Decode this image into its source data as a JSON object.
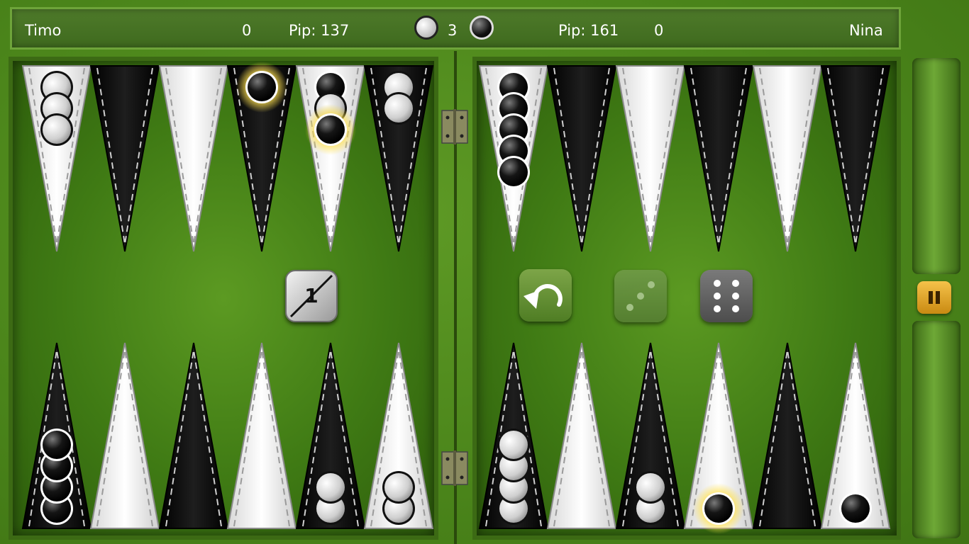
{
  "header": {
    "player_left": "Timo",
    "score_left": "0",
    "pip_left": "Pip: 137",
    "cube_value": "3",
    "pip_right": "Pip: 161",
    "score_right": "0",
    "player_right": "Nina"
  },
  "controls": {
    "doubling_cube_value": "1",
    "undo_icon": "undo-arrow-icon",
    "pause_icon": "pause-icon"
  },
  "dice": [
    {
      "value": 3,
      "used": true
    },
    {
      "value": 6,
      "used": false
    }
  ],
  "colors": {
    "felt": "#4a841a",
    "point_light": "#ffffff",
    "point_dark": "#111111",
    "highlight": "#ffe14d",
    "pause_button": "#e0a628"
  },
  "board": {
    "top_left_points": [
      {
        "point": 1,
        "checkers": 3,
        "color": "white"
      },
      {
        "point": 2,
        "checkers": 0,
        "color": null
      },
      {
        "point": 3,
        "checkers": 0,
        "color": null
      },
      {
        "point": 4,
        "checkers": 1,
        "color": "black",
        "highlight": true
      },
      {
        "point": 5,
        "checkers": 3,
        "color": "mixed",
        "highlight": true
      },
      {
        "point": 6,
        "checkers": 2,
        "color": "white"
      }
    ],
    "top_right_points": [
      {
        "point": 7,
        "checkers": 5,
        "color": "black"
      },
      {
        "point": 8,
        "checkers": 0,
        "color": null
      },
      {
        "point": 9,
        "checkers": 0,
        "color": null
      },
      {
        "point": 10,
        "checkers": 0,
        "color": null
      },
      {
        "point": 11,
        "checkers": 0,
        "color": null
      },
      {
        "point": 12,
        "checkers": 0,
        "color": null
      }
    ],
    "bottom_left_points": [
      {
        "point": 13,
        "checkers": 4,
        "color": "black"
      },
      {
        "point": 14,
        "checkers": 0,
        "color": null
      },
      {
        "point": 15,
        "checkers": 0,
        "color": null
      },
      {
        "point": 16,
        "checkers": 0,
        "color": null
      },
      {
        "point": 17,
        "checkers": 2,
        "color": "white"
      },
      {
        "point": 18,
        "checkers": 2,
        "color": "white"
      }
    ],
    "bottom_right_points": [
      {
        "point": 19,
        "checkers": 4,
        "color": "white"
      },
      {
        "point": 20,
        "checkers": 0,
        "color": null
      },
      {
        "point": 21,
        "checkers": 2,
        "color": "white"
      },
      {
        "point": 22,
        "checkers": 1,
        "color": "black",
        "highlight": true
      },
      {
        "point": 23,
        "checkers": 0,
        "color": null
      },
      {
        "point": 24,
        "checkers": 1,
        "color": "black"
      }
    ]
  }
}
